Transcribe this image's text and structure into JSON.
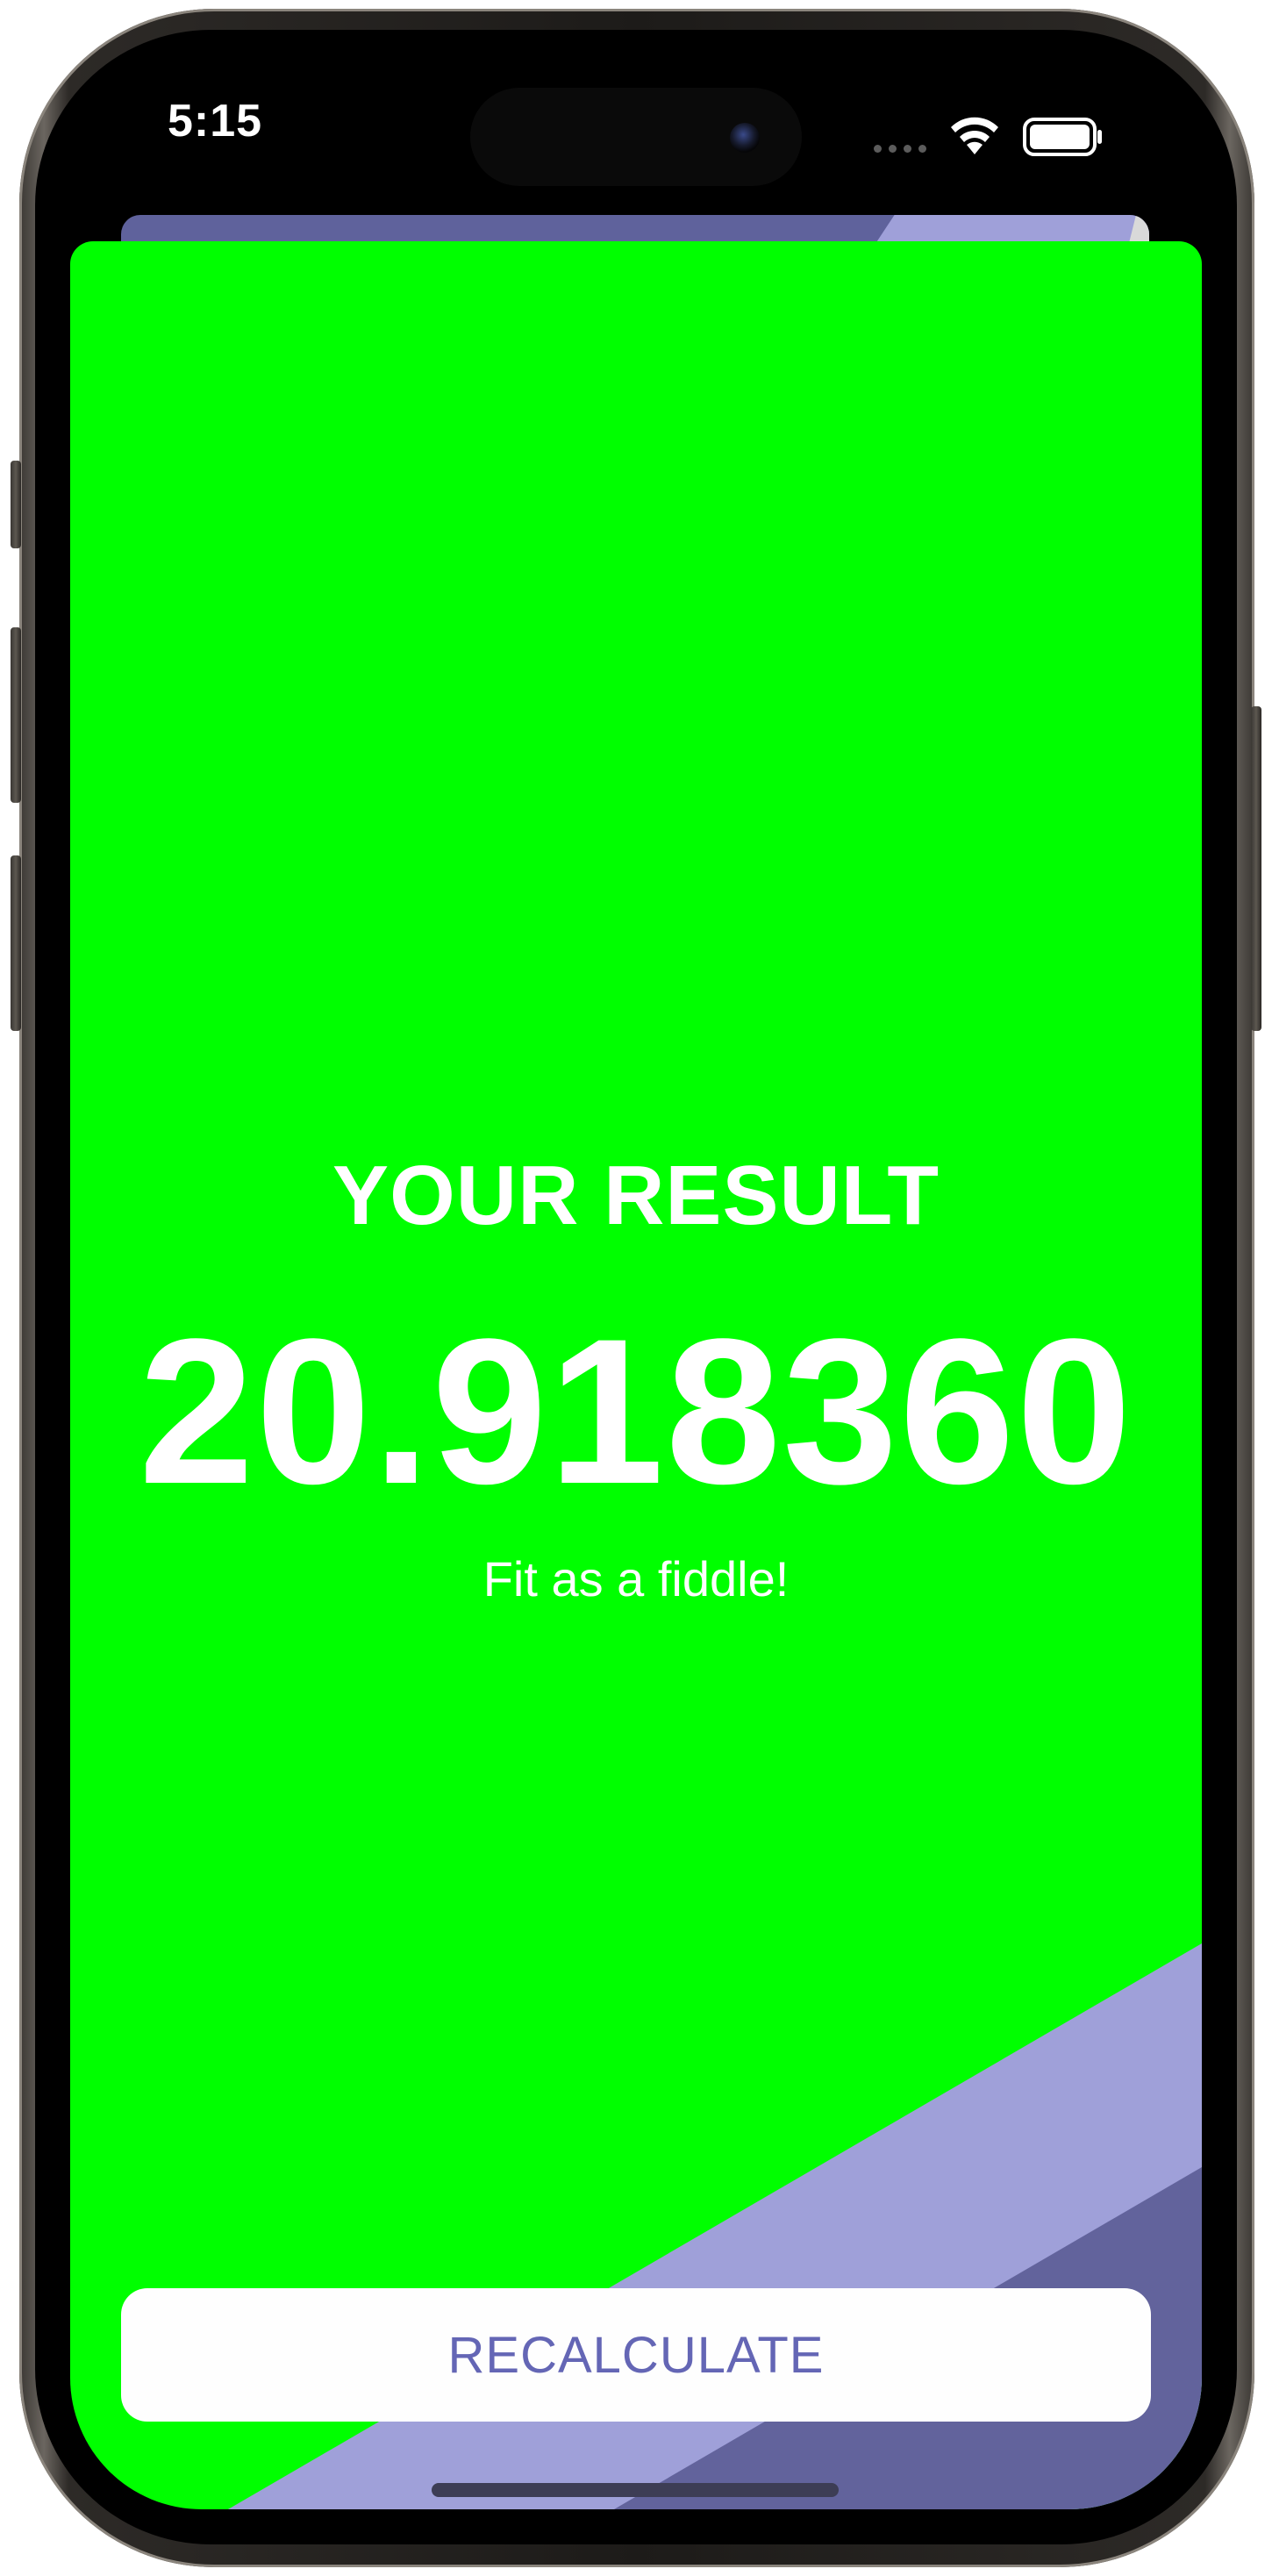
{
  "status_bar": {
    "time": "5:15",
    "wifi_icon": "wifi-icon",
    "battery_icon": "battery-icon"
  },
  "colors": {
    "result_background": "#00ff00",
    "accent_light": "#9fa0d9",
    "accent_dark": "#5f629c",
    "button_text": "#6466b5"
  },
  "result": {
    "title": "YOUR RESULT",
    "value": "20.918360",
    "advice": "Fit as a fiddle!"
  },
  "actions": {
    "recalculate_label": "RECALCULATE"
  }
}
